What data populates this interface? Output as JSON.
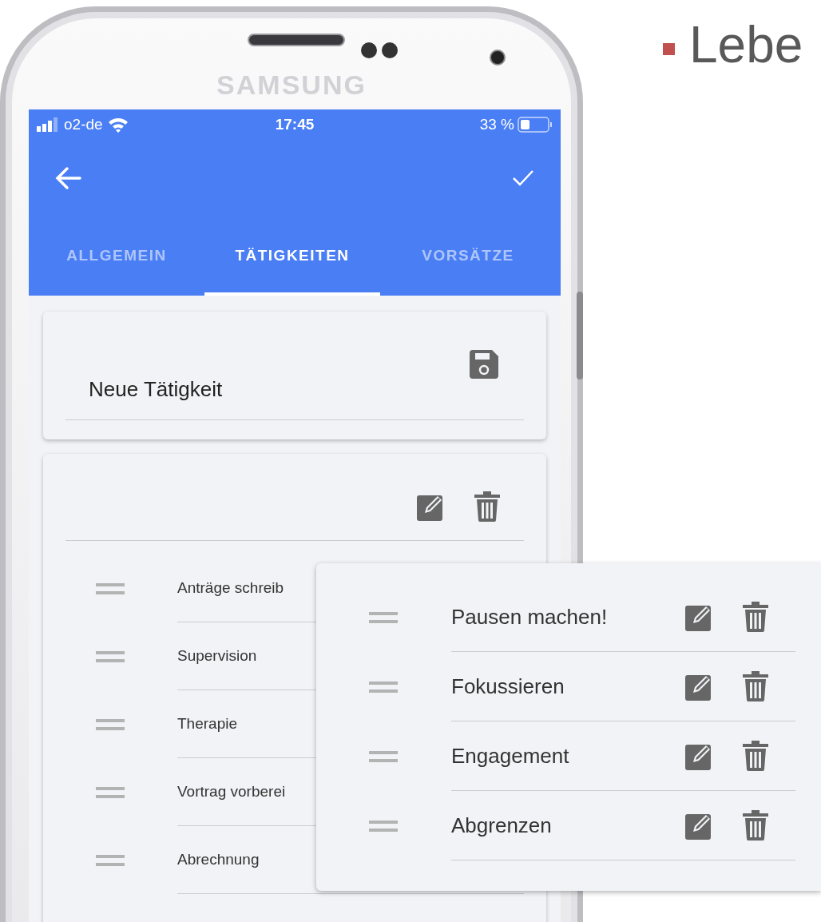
{
  "slide_title": "Lebe",
  "phone": {
    "brand": "SAMSUNG"
  },
  "status_bar": {
    "carrier": "o2-de",
    "time": "17:45",
    "battery": "33 %"
  },
  "tabs": [
    {
      "label": "ALLGEMEIN",
      "selected": false
    },
    {
      "label": "TÄTIGKEITEN",
      "selected": true
    },
    {
      "label": "VORSÄTZE",
      "selected": false
    }
  ],
  "new_activity_field": {
    "value": "Neue Tätigkeit"
  },
  "activities": [
    "Anträge schreib",
    "Supervision",
    "Therapie",
    "Vortrag vorberei",
    "Abrechnung"
  ],
  "intentions_panel": {
    "items": [
      "Pausen machen!",
      "Fokussieren",
      "Engagement",
      "Abgrenzen"
    ]
  }
}
